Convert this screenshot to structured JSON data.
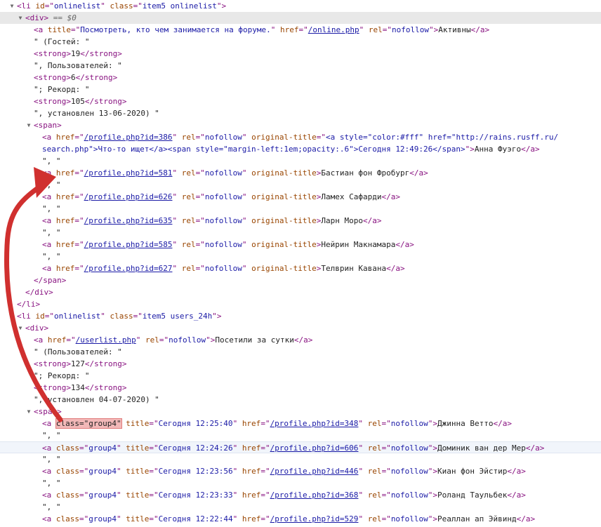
{
  "lines": [
    {
      "indent": 0,
      "tri": "▼",
      "parts": [
        [
          "tag",
          "<li "
        ],
        [
          "attr",
          "id"
        ],
        [
          "tag",
          "=\""
        ],
        [
          "val",
          "onlinelist"
        ],
        [
          "tag",
          "\" "
        ],
        [
          "attr",
          "class"
        ],
        [
          "tag",
          "=\""
        ],
        [
          "val",
          "item5 onlinelist"
        ],
        [
          "tag",
          "\">"
        ]
      ]
    },
    {
      "indent": 1,
      "tri": "▼",
      "selected": true,
      "parts": [
        [
          "tag",
          "<div>"
        ],
        [
          "marker",
          " == $0"
        ]
      ]
    },
    {
      "indent": 2,
      "parts": [
        [
          "tag",
          "<a "
        ],
        [
          "attr",
          "title"
        ],
        [
          "tag",
          "=\""
        ],
        [
          "val",
          "Посмотреть, кто чем занимается на форуме."
        ],
        [
          "tag",
          "\" "
        ],
        [
          "attr",
          "href"
        ],
        [
          "tag",
          "=\""
        ],
        [
          "link",
          "/online.php"
        ],
        [
          "tag",
          "\" "
        ],
        [
          "attr",
          "rel"
        ],
        [
          "tag",
          "=\""
        ],
        [
          "val",
          "nofollow"
        ],
        [
          "tag",
          "\">"
        ],
        [
          "txt",
          "Активны"
        ],
        [
          "tag",
          "</a>"
        ]
      ]
    },
    {
      "indent": 2,
      "parts": [
        [
          "txt",
          "\" (Гостей: \""
        ]
      ]
    },
    {
      "indent": 2,
      "parts": [
        [
          "tag",
          "<strong>"
        ],
        [
          "txt",
          "19"
        ],
        [
          "tag",
          "</strong>"
        ]
      ]
    },
    {
      "indent": 2,
      "parts": [
        [
          "txt",
          "\", Пользователей: \""
        ]
      ]
    },
    {
      "indent": 2,
      "parts": [
        [
          "tag",
          "<strong>"
        ],
        [
          "txt",
          "6"
        ],
        [
          "tag",
          "</strong>"
        ]
      ]
    },
    {
      "indent": 2,
      "parts": [
        [
          "txt",
          "\"; Рекорд: \""
        ]
      ]
    },
    {
      "indent": 2,
      "parts": [
        [
          "tag",
          "<strong>"
        ],
        [
          "txt",
          "105"
        ],
        [
          "tag",
          "</strong>"
        ]
      ]
    },
    {
      "indent": 2,
      "parts": [
        [
          "txt",
          "\", установлен 13-06-2020) \""
        ]
      ]
    },
    {
      "indent": 2,
      "tri": "▼",
      "parts": [
        [
          "tag",
          "<span>"
        ]
      ]
    },
    {
      "indent": 3,
      "parts": [
        [
          "tag",
          "<a "
        ],
        [
          "attr",
          "href"
        ],
        [
          "tag",
          "=\""
        ],
        [
          "link",
          "/profile.php?id=386"
        ],
        [
          "tag",
          "\" "
        ],
        [
          "attr",
          "rel"
        ],
        [
          "tag",
          "=\""
        ],
        [
          "val",
          "nofollow"
        ],
        [
          "tag",
          "\" "
        ],
        [
          "attr",
          "original-title"
        ],
        [
          "tag",
          "=\""
        ],
        [
          "val",
          "<a style=\"color:#fff\" href=\"http://rains.rusff.ru/"
        ]
      ]
    },
    {
      "indent": 3,
      "parts": [
        [
          "val",
          "search.php\">Что-то ищет</a><span style=\"margin-left:1em;opacity:.6\">Сегодня 12:49:26</span>"
        ],
        [
          "tag",
          "\">"
        ],
        [
          "txt",
          "Анна Фуэго"
        ],
        [
          "tag",
          "</a>"
        ]
      ]
    },
    {
      "indent": 3,
      "parts": [
        [
          "txt",
          "\", \""
        ]
      ]
    },
    {
      "indent": 3,
      "parts": [
        [
          "tag",
          "<a "
        ],
        [
          "attr",
          "href"
        ],
        [
          "tag",
          "=\""
        ],
        [
          "link",
          "/profile.php?id=581"
        ],
        [
          "tag",
          "\" "
        ],
        [
          "attr",
          "rel"
        ],
        [
          "tag",
          "=\""
        ],
        [
          "val",
          "nofollow"
        ],
        [
          "tag",
          "\" "
        ],
        [
          "attr",
          "original-title"
        ],
        [
          "tag",
          ">"
        ],
        [
          "txt",
          "Бастиан фон Фробург"
        ],
        [
          "tag",
          "</a>"
        ]
      ]
    },
    {
      "indent": 3,
      "parts": [
        [
          "txt",
          "\", \""
        ]
      ]
    },
    {
      "indent": 3,
      "parts": [
        [
          "tag",
          "<a "
        ],
        [
          "attr",
          "href"
        ],
        [
          "tag",
          "=\""
        ],
        [
          "link",
          "/profile.php?id=626"
        ],
        [
          "tag",
          "\" "
        ],
        [
          "attr",
          "rel"
        ],
        [
          "tag",
          "=\""
        ],
        [
          "val",
          "nofollow"
        ],
        [
          "tag",
          "\" "
        ],
        [
          "attr",
          "original-title"
        ],
        [
          "tag",
          ">"
        ],
        [
          "txt",
          "Ламех Сафарди"
        ],
        [
          "tag",
          "</a>"
        ]
      ]
    },
    {
      "indent": 3,
      "parts": [
        [
          "txt",
          "\", \""
        ]
      ]
    },
    {
      "indent": 3,
      "parts": [
        [
          "tag",
          "<a "
        ],
        [
          "attr",
          "href"
        ],
        [
          "tag",
          "=\""
        ],
        [
          "link",
          "/profile.php?id=635"
        ],
        [
          "tag",
          "\" "
        ],
        [
          "attr",
          "rel"
        ],
        [
          "tag",
          "=\""
        ],
        [
          "val",
          "nofollow"
        ],
        [
          "tag",
          "\" "
        ],
        [
          "attr",
          "original-title"
        ],
        [
          "tag",
          ">"
        ],
        [
          "txt",
          "Ларн Моро"
        ],
        [
          "tag",
          "</a>"
        ]
      ]
    },
    {
      "indent": 3,
      "parts": [
        [
          "txt",
          "\", \""
        ]
      ]
    },
    {
      "indent": 3,
      "parts": [
        [
          "tag",
          "<a "
        ],
        [
          "attr",
          "href"
        ],
        [
          "tag",
          "=\""
        ],
        [
          "link",
          "/profile.php?id=585"
        ],
        [
          "tag",
          "\" "
        ],
        [
          "attr",
          "rel"
        ],
        [
          "tag",
          "=\""
        ],
        [
          "val",
          "nofollow"
        ],
        [
          "tag",
          "\" "
        ],
        [
          "attr",
          "original-title"
        ],
        [
          "tag",
          ">"
        ],
        [
          "txt",
          "Нейрин Макнамара"
        ],
        [
          "tag",
          "</a>"
        ]
      ]
    },
    {
      "indent": 3,
      "parts": [
        [
          "txt",
          "\", \""
        ]
      ]
    },
    {
      "indent": 3,
      "parts": [
        [
          "tag",
          "<a "
        ],
        [
          "attr",
          "href"
        ],
        [
          "tag",
          "=\""
        ],
        [
          "link",
          "/profile.php?id=627"
        ],
        [
          "tag",
          "\" "
        ],
        [
          "attr",
          "rel"
        ],
        [
          "tag",
          "=\""
        ],
        [
          "val",
          "nofollow"
        ],
        [
          "tag",
          "\" "
        ],
        [
          "attr",
          "original-title"
        ],
        [
          "tag",
          ">"
        ],
        [
          "txt",
          "Телврин Кавана"
        ],
        [
          "tag",
          "</a>"
        ]
      ]
    },
    {
      "indent": 2,
      "parts": [
        [
          "tag",
          "</span>"
        ]
      ]
    },
    {
      "indent": 1,
      "parts": [
        [
          "tag",
          "</div>"
        ]
      ]
    },
    {
      "indent": 0,
      "parts": [
        [
          "tag",
          "</li>"
        ]
      ]
    },
    {
      "indent": 0,
      "tri": "▼",
      "parts": [
        [
          "tag",
          "<li "
        ],
        [
          "attr",
          "id"
        ],
        [
          "tag",
          "=\""
        ],
        [
          "val",
          "onlinelist"
        ],
        [
          "tag",
          "\" "
        ],
        [
          "attr",
          "class"
        ],
        [
          "tag",
          "=\""
        ],
        [
          "val",
          "item5 users_24h"
        ],
        [
          "tag",
          "\">"
        ]
      ]
    },
    {
      "indent": 1,
      "tri": "▼",
      "parts": [
        [
          "tag",
          "<div>"
        ]
      ]
    },
    {
      "indent": 2,
      "parts": [
        [
          "tag",
          "<a "
        ],
        [
          "attr",
          "href"
        ],
        [
          "tag",
          "=\""
        ],
        [
          "link",
          "/userlist.php"
        ],
        [
          "tag",
          "\" "
        ],
        [
          "attr",
          "rel"
        ],
        [
          "tag",
          "=\""
        ],
        [
          "val",
          "nofollow"
        ],
        [
          "tag",
          "\">"
        ],
        [
          "txt",
          "Посетили за сутки"
        ],
        [
          "tag",
          "</a>"
        ]
      ]
    },
    {
      "indent": 2,
      "parts": [
        [
          "txt",
          "\" (Пользователей: \""
        ]
      ]
    },
    {
      "indent": 2,
      "parts": [
        [
          "tag",
          "<strong>"
        ],
        [
          "txt",
          "127"
        ],
        [
          "tag",
          "</strong>"
        ]
      ]
    },
    {
      "indent": 2,
      "parts": [
        [
          "txt",
          "\"; Рекорд: \""
        ]
      ]
    },
    {
      "indent": 2,
      "parts": [
        [
          "tag",
          "<strong>"
        ],
        [
          "txt",
          "134"
        ],
        [
          "tag",
          "</strong>"
        ]
      ]
    },
    {
      "indent": 2,
      "parts": [
        [
          "txt",
          "\", установлен 04-07-2020) \""
        ]
      ]
    },
    {
      "indent": 2,
      "tri": "▼",
      "parts": [
        [
          "tag",
          "<span>"
        ]
      ]
    },
    {
      "indent": 3,
      "parts": [
        [
          "tag",
          "<a "
        ],
        [
          "hl",
          "class=\"group4\""
        ],
        [
          "tag",
          " "
        ],
        [
          "attr",
          "title"
        ],
        [
          "tag",
          "=\""
        ],
        [
          "val",
          "Сегодня 12:25:40"
        ],
        [
          "tag",
          "\" "
        ],
        [
          "attr",
          "href"
        ],
        [
          "tag",
          "=\""
        ],
        [
          "link",
          "/profile.php?id=348"
        ],
        [
          "tag",
          "\" "
        ],
        [
          "attr",
          "rel"
        ],
        [
          "tag",
          "=\""
        ],
        [
          "val",
          "nofollow"
        ],
        [
          "tag",
          "\">"
        ],
        [
          "txt",
          "Джинна Ветто"
        ],
        [
          "tag",
          "</a>"
        ]
      ]
    },
    {
      "indent": 3,
      "parts": [
        [
          "txt",
          "\", \""
        ]
      ]
    },
    {
      "indent": 3,
      "hover": true,
      "parts": [
        [
          "tag",
          "<a "
        ],
        [
          "attr",
          "class"
        ],
        [
          "tag",
          "=\""
        ],
        [
          "val",
          "group4"
        ],
        [
          "tag",
          "\" "
        ],
        [
          "attr",
          "title"
        ],
        [
          "tag",
          "=\""
        ],
        [
          "val",
          "Сегодня 12:24:26"
        ],
        [
          "tag",
          "\" "
        ],
        [
          "attr",
          "href"
        ],
        [
          "tag",
          "=\""
        ],
        [
          "link",
          "/profile.php?id=606"
        ],
        [
          "tag",
          "\" "
        ],
        [
          "attr",
          "rel"
        ],
        [
          "tag",
          "=\""
        ],
        [
          "val",
          "nofollow"
        ],
        [
          "tag",
          "\">"
        ],
        [
          "txt",
          "Доминик ван дер Мер"
        ],
        [
          "tag",
          "</a>"
        ]
      ]
    },
    {
      "indent": 3,
      "parts": [
        [
          "txt",
          "\", \""
        ]
      ]
    },
    {
      "indent": 3,
      "parts": [
        [
          "tag",
          "<a "
        ],
        [
          "attr",
          "class"
        ],
        [
          "tag",
          "=\""
        ],
        [
          "val",
          "group4"
        ],
        [
          "tag",
          "\" "
        ],
        [
          "attr",
          "title"
        ],
        [
          "tag",
          "=\""
        ],
        [
          "val",
          "Сегодня 12:23:56"
        ],
        [
          "tag",
          "\" "
        ],
        [
          "attr",
          "href"
        ],
        [
          "tag",
          "=\""
        ],
        [
          "link",
          "/profile.php?id=446"
        ],
        [
          "tag",
          "\" "
        ],
        [
          "attr",
          "rel"
        ],
        [
          "tag",
          "=\""
        ],
        [
          "val",
          "nofollow"
        ],
        [
          "tag",
          "\">"
        ],
        [
          "txt",
          "Киан фон Эйстир"
        ],
        [
          "tag",
          "</a>"
        ]
      ]
    },
    {
      "indent": 3,
      "parts": [
        [
          "txt",
          "\", \""
        ]
      ]
    },
    {
      "indent": 3,
      "parts": [
        [
          "tag",
          "<a "
        ],
        [
          "attr",
          "class"
        ],
        [
          "tag",
          "=\""
        ],
        [
          "val",
          "group4"
        ],
        [
          "tag",
          "\" "
        ],
        [
          "attr",
          "title"
        ],
        [
          "tag",
          "=\""
        ],
        [
          "val",
          "Сегодня 12:23:33"
        ],
        [
          "tag",
          "\" "
        ],
        [
          "attr",
          "href"
        ],
        [
          "tag",
          "=\""
        ],
        [
          "link",
          "/profile.php?id=368"
        ],
        [
          "tag",
          "\" "
        ],
        [
          "attr",
          "rel"
        ],
        [
          "tag",
          "=\""
        ],
        [
          "val",
          "nofollow"
        ],
        [
          "tag",
          "\">"
        ],
        [
          "txt",
          "Роланд Таульбек"
        ],
        [
          "tag",
          "</a>"
        ]
      ]
    },
    {
      "indent": 3,
      "parts": [
        [
          "txt",
          "\", \""
        ]
      ]
    },
    {
      "indent": 3,
      "parts": [
        [
          "tag",
          "<a "
        ],
        [
          "attr",
          "class"
        ],
        [
          "tag",
          "=\""
        ],
        [
          "val",
          "group4"
        ],
        [
          "tag",
          "\" "
        ],
        [
          "attr",
          "title"
        ],
        [
          "tag",
          "=\""
        ],
        [
          "val",
          "Сегодня 12:22:44"
        ],
        [
          "tag",
          "\" "
        ],
        [
          "attr",
          "href"
        ],
        [
          "tag",
          "=\""
        ],
        [
          "link",
          "/profile.php?id=529"
        ],
        [
          "tag",
          "\" "
        ],
        [
          "attr",
          "rel"
        ],
        [
          "tag",
          "=\""
        ],
        [
          "val",
          "nofollow"
        ],
        [
          "tag",
          "\">"
        ],
        [
          "txt",
          "Реаллан ап Эйвинд"
        ],
        [
          "tag",
          "</a>"
        ]
      ]
    }
  ],
  "colors": {
    "tag": "#881280",
    "attribute": "#994500",
    "value": "#1a1aa6",
    "highlight": "#f2b8b8",
    "arrow": "#d0302f"
  }
}
